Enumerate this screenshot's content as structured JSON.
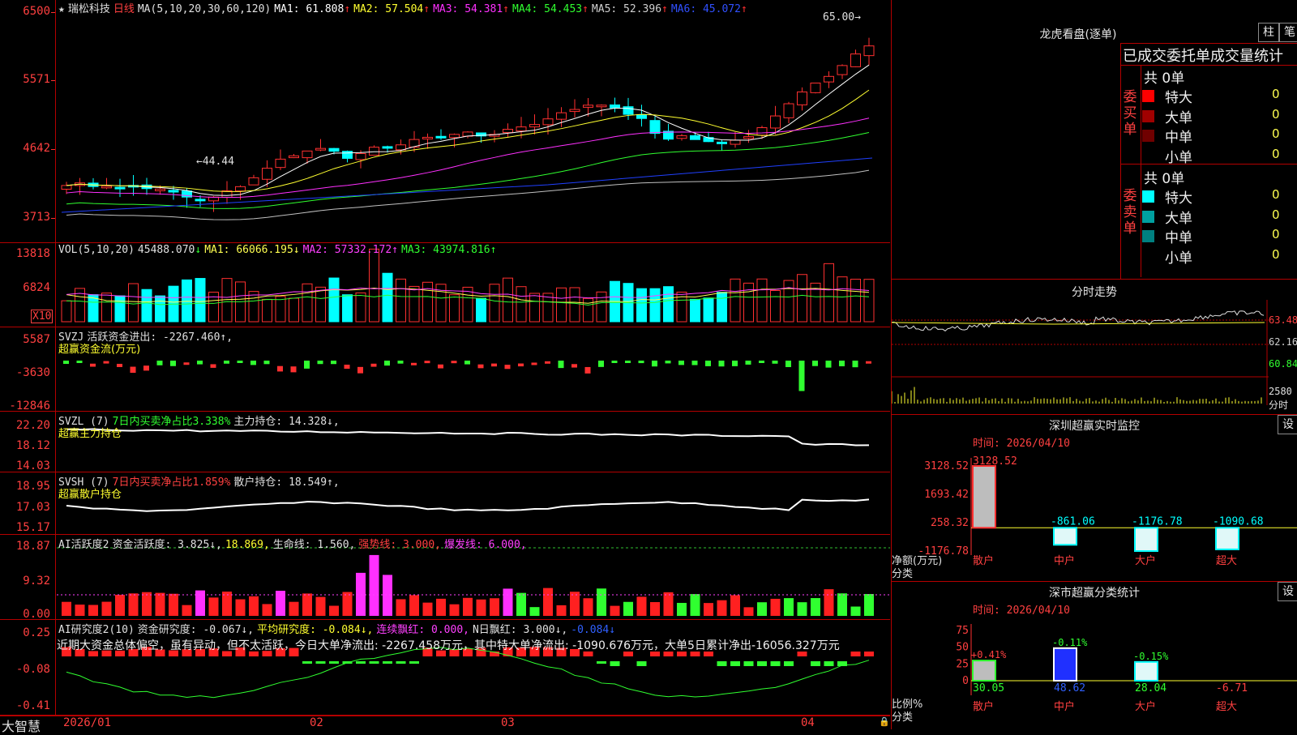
{
  "stock": {
    "star": "★",
    "name": "瑞松科技",
    "period": "日线",
    "ma_label": "MA(5,10,20,30,60,120)",
    "ma": [
      {
        "label": "MA1:",
        "value": "61.808",
        "arrow": "↑",
        "color": "#ffffff"
      },
      {
        "label": "MA2:",
        "value": "57.504",
        "arrow": "↑",
        "color": "#ffff30"
      },
      {
        "label": "MA3:",
        "value": "54.381",
        "arrow": "↑",
        "color": "#ff30ff"
      },
      {
        "label": "MA4:",
        "value": "54.453",
        "arrow": "↑",
        "color": "#30ff30"
      },
      {
        "label": "MA5:",
        "value": "52.396",
        "arrow": "↑",
        "color": "#d0d0d0"
      },
      {
        "label": "MA6:",
        "value": "45.072",
        "arrow": "↑",
        "color": "#3050ff"
      }
    ],
    "high_mark": "65.00",
    "low_mark": "44.44"
  },
  "axes": {
    "price": [
      "6500",
      "5571",
      "4642",
      "3713"
    ],
    "vol": [
      "13818",
      "6824"
    ],
    "vol_unit": "X10",
    "svzj": [
      "5587",
      "-3630",
      "-12846"
    ],
    "svzl": [
      "22.20",
      "18.12",
      "14.03"
    ],
    "svsh": [
      "18.95",
      "17.03",
      "15.17"
    ],
    "ai1": [
      "18.87",
      "9.32",
      "0.00"
    ],
    "ai2": [
      "0.25",
      "-0.08",
      "-0.41"
    ]
  },
  "vol_header": {
    "title": "VOL(5,10,20)",
    "value": "45488.070",
    "arrow": "↓",
    "ma1": "MA1: 66066.195↓",
    "ma2": "MA2: 57332.172↑",
    "ma3": "MA3: 43974.816↑"
  },
  "svzj_header": {
    "title": "SVZJ",
    "text": "活跃资金进出: -2267.460↑,",
    "sub": "超赢资金流(万元)"
  },
  "svzl_header": {
    "title": "SVZL (7)",
    "text1": "7日内买卖净占比3.338%",
    "text2": "主力持仓: 14.328↓,",
    "sub": "超赢主力持仓"
  },
  "svsh_header": {
    "title": "SVSH (7)",
    "text1": "7日内买卖净占比1.859%",
    "text2": "散户持仓: 18.549↑,",
    "sub": "超赢散户持仓"
  },
  "ai1_header": {
    "title": "AI活跃度2",
    "a": "资金活跃度: 3.825↓,",
    "b": "18.869,",
    "c": "生命线: 1.560,",
    "d": "强势线: 3.000,",
    "e": "爆发线: 6.000,"
  },
  "ai2_header": {
    "title": "AI研究度2(10)",
    "a": "资金研究度: -0.067↓,",
    "b": "平均研究度: -0.084↓,",
    "c": "连续飘红: 0.000,",
    "d": "N日飘红: 3.000↓,",
    "e": "-0.084↓",
    "summary": "近期大资金总体偏空，虽有异动，但不太活跃，今日大单净流出: -2267.458万元，其中特大单净流出: -1090.676万元，大单5日累计净出-16056.327万元"
  },
  "dates": [
    "2026/01",
    "02",
    "03",
    "04"
  ],
  "brand": "大智慧",
  "right": {
    "dragon_title": "龙虎看盘(逐单)",
    "btn_bar": "柱",
    "btn_pen": "笔",
    "order_title": "已成交委托单成交量统计",
    "buy_vertical": "委买单",
    "sell_vertical": "委卖单",
    "buy_total": "共 0单",
    "sell_total": "共 0单",
    "buy_rows": [
      {
        "label": "特大",
        "count": "0",
        "pct": "0%",
        "color": "#ff0000"
      },
      {
        "label": "大单",
        "count": "0",
        "pct": "0%",
        "color": "#a00000"
      },
      {
        "label": "中单",
        "count": "0",
        "pct": "0%",
        "color": "#700000"
      },
      {
        "label": "小单",
        "count": "0",
        "pct": "0%",
        "color": "transparent"
      }
    ],
    "sell_rows": [
      {
        "label": "特大",
        "count": "0",
        "pct": "0%",
        "color": "#00ffff"
      },
      {
        "label": "大单",
        "count": "0",
        "pct": "0%",
        "color": "#00a0a0"
      },
      {
        "label": "中单",
        "count": "0",
        "pct": "0%",
        "color": "#008080"
      },
      {
        "label": "小单",
        "count": "0",
        "pct": "0%",
        "color": "transparent"
      }
    ],
    "minute_title": "分时走势",
    "minute_axis": [
      "63.48",
      "62.16",
      "60.84"
    ],
    "minute_vol": "2580",
    "minute_vol_unit": "分时",
    "sz_title": "深圳超赢实时监控",
    "set_btn": "设",
    "sz_time": "时间: 2026/04/10",
    "sz_axis": [
      "3128.52",
      "1693.42",
      "258.32",
      "-1176.78"
    ],
    "sz_bars": [
      {
        "cat": "散户",
        "value": 3128.52,
        "label": "3128.52"
      },
      {
        "cat": "中户",
        "value": -861.06,
        "label": "-861.06"
      },
      {
        "cat": "大户",
        "value": -1176.78,
        "label": "-1176.78"
      },
      {
        "cat": "超大",
        "value": -1090.68,
        "label": "-1090.68"
      }
    ],
    "sz_ylabel": "净额(万元)",
    "sz_xlabel": "分类",
    "sc_title": "深市超赢分类统计",
    "sc_time": "时间: 2026/04/10",
    "sc_axis": [
      "75",
      "50",
      "25",
      "0"
    ],
    "sc_bars": [
      {
        "cat": "散户",
        "value": 30.05,
        "change": "+0.41%"
      },
      {
        "cat": "中户",
        "value": 48.62,
        "change": "-0.11%"
      },
      {
        "cat": "大户",
        "value": 28.04,
        "change": "-0.15%"
      },
      {
        "cat": "超大",
        "value": -6.71,
        "change": ""
      }
    ],
    "sc_ylabel": "比例%",
    "sc_xlabel": "分类"
  }
}
